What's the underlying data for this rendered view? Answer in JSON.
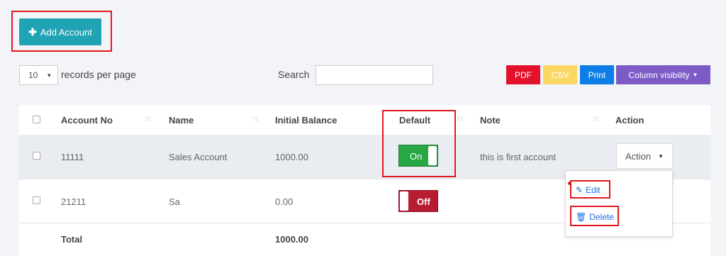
{
  "toolbar": {
    "add_label": "Add Account"
  },
  "length": {
    "value": "10",
    "label": "records per page"
  },
  "search": {
    "label": "Search",
    "value": ""
  },
  "export": {
    "pdf": "PDF",
    "csv": "CSV",
    "print": "Print",
    "column_visibility": "Column visibility"
  },
  "table": {
    "headers": {
      "account_no": "Account No",
      "name": "Name",
      "initial_balance": "Initial Balance",
      "default": "Default",
      "note": "Note",
      "action": "Action"
    },
    "rows": [
      {
        "account_no": "11111",
        "name": "Sales Account",
        "initial_balance": "1000.00",
        "default": "On",
        "note": "this is first account",
        "action": "Action"
      },
      {
        "account_no": "21211",
        "name": "Sa",
        "initial_balance": "0.00",
        "default": "Off",
        "note": ""
      }
    ],
    "footer": {
      "label": "Total",
      "initial_balance": "1000.00"
    }
  },
  "dropdown": {
    "edit": "Edit",
    "delete": "Delete"
  },
  "colors": {
    "add_button": "#20a3b5",
    "pdf": "#e3122a",
    "csv": "#fcd663",
    "print": "#0d7ee8",
    "column_visibility": "#7c5bc6",
    "toggle_on": "#28a745",
    "toggle_off": "#b71c33",
    "highlight": "#e0181e"
  }
}
